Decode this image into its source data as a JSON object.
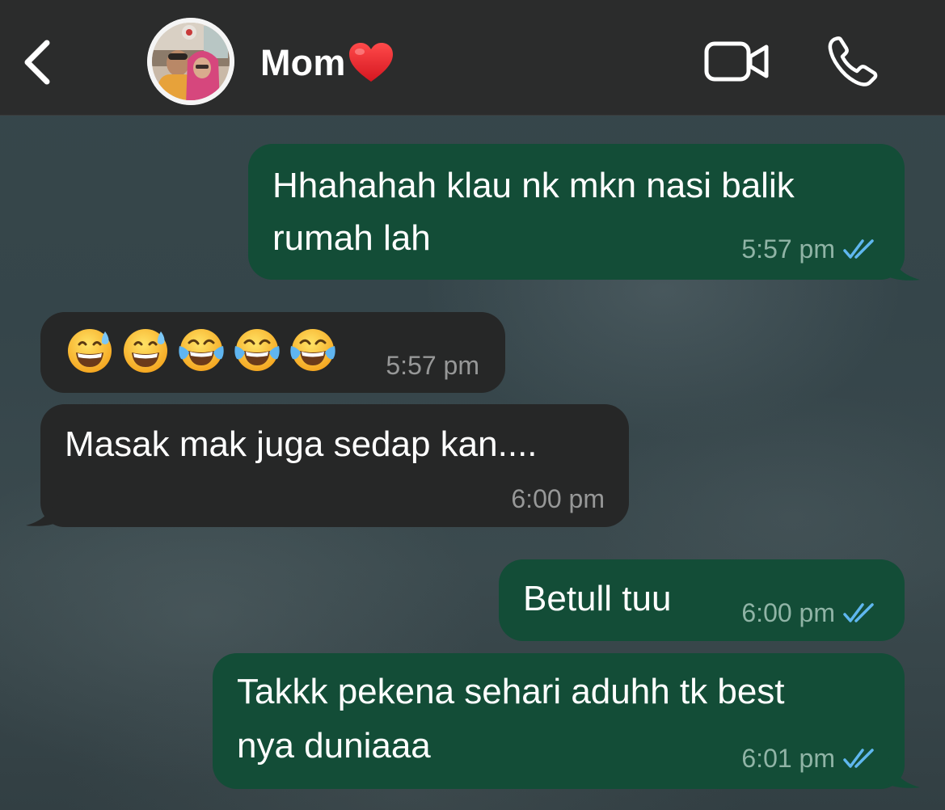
{
  "header": {
    "contact_name": "Mom",
    "icons": {
      "back": "chevron-left-icon",
      "heart": "red-heart-emoji",
      "video": "video-camera-icon",
      "call": "phone-icon"
    },
    "colors": {
      "header_bg": "#2b2c2c",
      "heart": "#e8202a"
    }
  },
  "messages": [
    {
      "direction": "outgoing",
      "lines": [
        "Hhahahah klau nk mkn nasi balik",
        "rumah lah"
      ],
      "time": "5:57 pm",
      "status": "read"
    },
    {
      "direction": "incoming",
      "emojis": [
        "grinning-sweat-emoji",
        "grinning-sweat-emoji",
        "tears-of-joy-emoji",
        "tears-of-joy-emoji",
        "tears-of-joy-emoji"
      ],
      "time": "5:57 pm"
    },
    {
      "direction": "incoming",
      "lines": [
        "Masak mak juga sedap kan...."
      ],
      "time": "6:00 pm"
    },
    {
      "direction": "outgoing",
      "lines": [
        "Betull tuu"
      ],
      "time": "6:00 pm",
      "status": "read"
    },
    {
      "direction": "outgoing",
      "lines": [
        "Takkk pekena sehari aduhh tk best",
        "nya duniaaa"
      ],
      "time": "6:01 pm",
      "status": "read"
    }
  ],
  "colors": {
    "outgoing_bubble": "#134d37",
    "incoming_bubble": "#262727",
    "read_ticks": "#5fb7ef"
  }
}
